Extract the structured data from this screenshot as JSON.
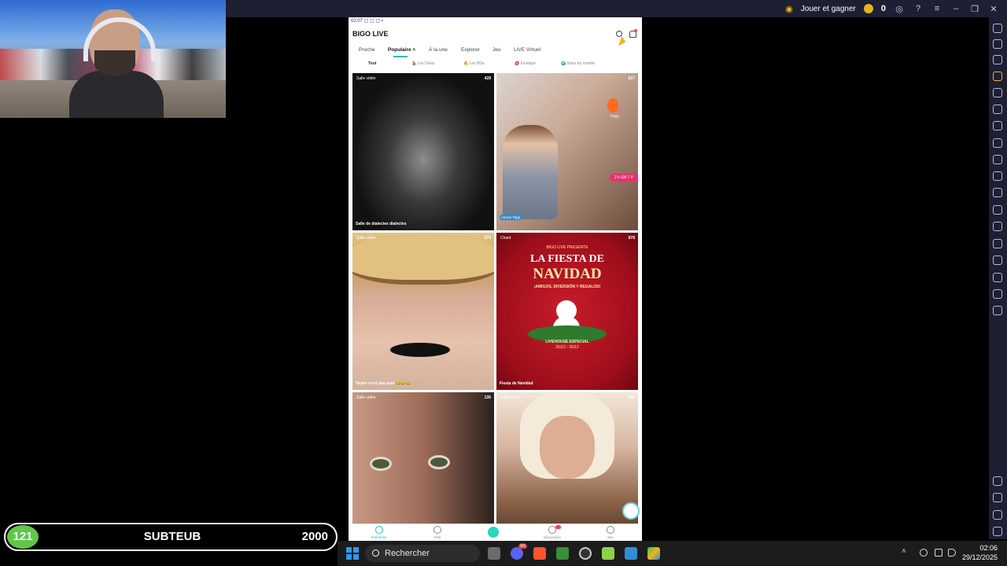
{
  "emulator": {
    "jouer_label": "Jouer et gagner",
    "coins": "0"
  },
  "phone": {
    "status_time": "02:07",
    "app_title": "BIGO LIVE",
    "tabs": [
      "Proche",
      "Populaire",
      "À la une",
      "Explorer",
      "Jeu",
      "LIVE Virtuel"
    ],
    "subtabs": [
      "Tout",
      "Les Divas",
      "Les BGs",
      "Exotique",
      "Stars du monde"
    ],
    "tiles": [
      {
        "tag": "Salle vidéo",
        "count": "428",
        "caption": "Salle de dialectes dialectes"
      },
      {
        "tag": "",
        "count": "637",
        "caption": "",
        "fire_label": "Gagn",
        "pill": "2 k SN 7 P",
        "badge": "Heure Tapp"
      },
      {
        "tag": "Salle vidéo",
        "count": "274",
        "caption": "Taylor n'est pas peur"
      },
      {
        "tag": "Chant",
        "count": "878",
        "caption": "Fiesta de Navidad",
        "banner_top": "BIGO LIVE PRESENTE",
        "banner_title1": "LA FIESTA DE",
        "banner_title2": "NAVIDAD",
        "banner_sub": "¡AMIGOS, DIVERSIÓN Y REGALOS!",
        "banner_ribbon": "LIVEHOUSE ESPECIAL",
        "banner_date": "25/12 - 25/12"
      },
      {
        "tag": "Salle vidéo",
        "count": "136",
        "caption": ""
      },
      {
        "tag": "Salle vidéo",
        "count": "306",
        "caption": ""
      }
    ],
    "nav": [
      "Rafraîchir",
      "Fête",
      "",
      "Discussion",
      "Moi"
    ],
    "nav_badge": "15"
  },
  "score": {
    "level": "121",
    "name": "SUBTEUB",
    "goal": "2000"
  },
  "taskbar": {
    "search_label": "Rechercher",
    "discord_badge": "99",
    "time": "02:06",
    "date": "29/12/2025"
  },
  "colors": {
    "accent": "#22c1b0",
    "emulator_bar": "#1d1f33",
    "score_badge": "#5fc74a"
  }
}
